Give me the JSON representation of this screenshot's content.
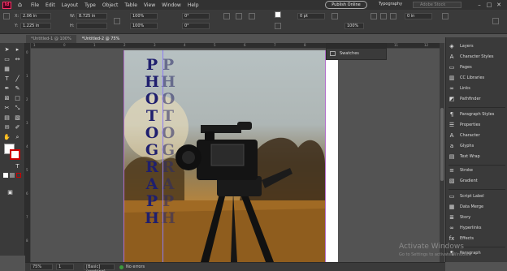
{
  "app": {
    "logo": "Id",
    "menu": [
      "File",
      "Edit",
      "Layout",
      "Type",
      "Object",
      "Table",
      "View",
      "Window",
      "Help"
    ],
    "zoom": "75%",
    "publish_label": "Publish Online",
    "workspace_label": "Typography",
    "stock_placeholder": "Adobe Stock"
  },
  "controlbar": {
    "x_label": "X:",
    "x_value": "2.06 in",
    "y_label": "Y:",
    "y_value": "1.225 in",
    "w_label": "W:",
    "w_value": "8.725 in",
    "h_label": "H:",
    "h_value": "",
    "scale_x": "100%",
    "scale_y": "100%",
    "rotate": "0°",
    "shear": "0°",
    "stroke_weight": "0 pt",
    "opacity": "100%",
    "effect_value": "0 in"
  },
  "tabs": [
    {
      "label": "*Untitled-1 @ 100%",
      "active": false
    },
    {
      "label": "*Untitled-2 @ 75%",
      "active": true
    }
  ],
  "ruler": {
    "top_ticks": [
      "1",
      "0",
      "1",
      "2",
      "3",
      "4",
      "5",
      "6",
      "7",
      "8",
      "9",
      "10",
      "11",
      "12"
    ],
    "left_ticks": [
      "0",
      "1",
      "2",
      "3",
      "4",
      "5",
      "6",
      "7",
      "8"
    ]
  },
  "document": {
    "title_text": "PHOTOGRAPH",
    "title_color": "#1f1f6e",
    "reflection_color": "#2a2a66"
  },
  "swatches": {
    "label": "Swatches"
  },
  "panels": [
    "Layers",
    "Character Styles",
    "Pages",
    "CC Libraries",
    "Links",
    "Pathfinder",
    "Paragraph Styles",
    "Properties",
    "Character",
    "Glyphs",
    "Text Wrap",
    "Stroke",
    "Gradient",
    "Script Label",
    "Data Merge",
    "Story",
    "Hyperlinks",
    "Effects",
    "Paragraph"
  ],
  "status": {
    "zoom": "75%",
    "page": "1",
    "style": "[Basic] (working)",
    "errors": "No errors"
  },
  "watermark": {
    "line1": "Activate Windows",
    "line2": "Go to Settings to activate Windows."
  }
}
